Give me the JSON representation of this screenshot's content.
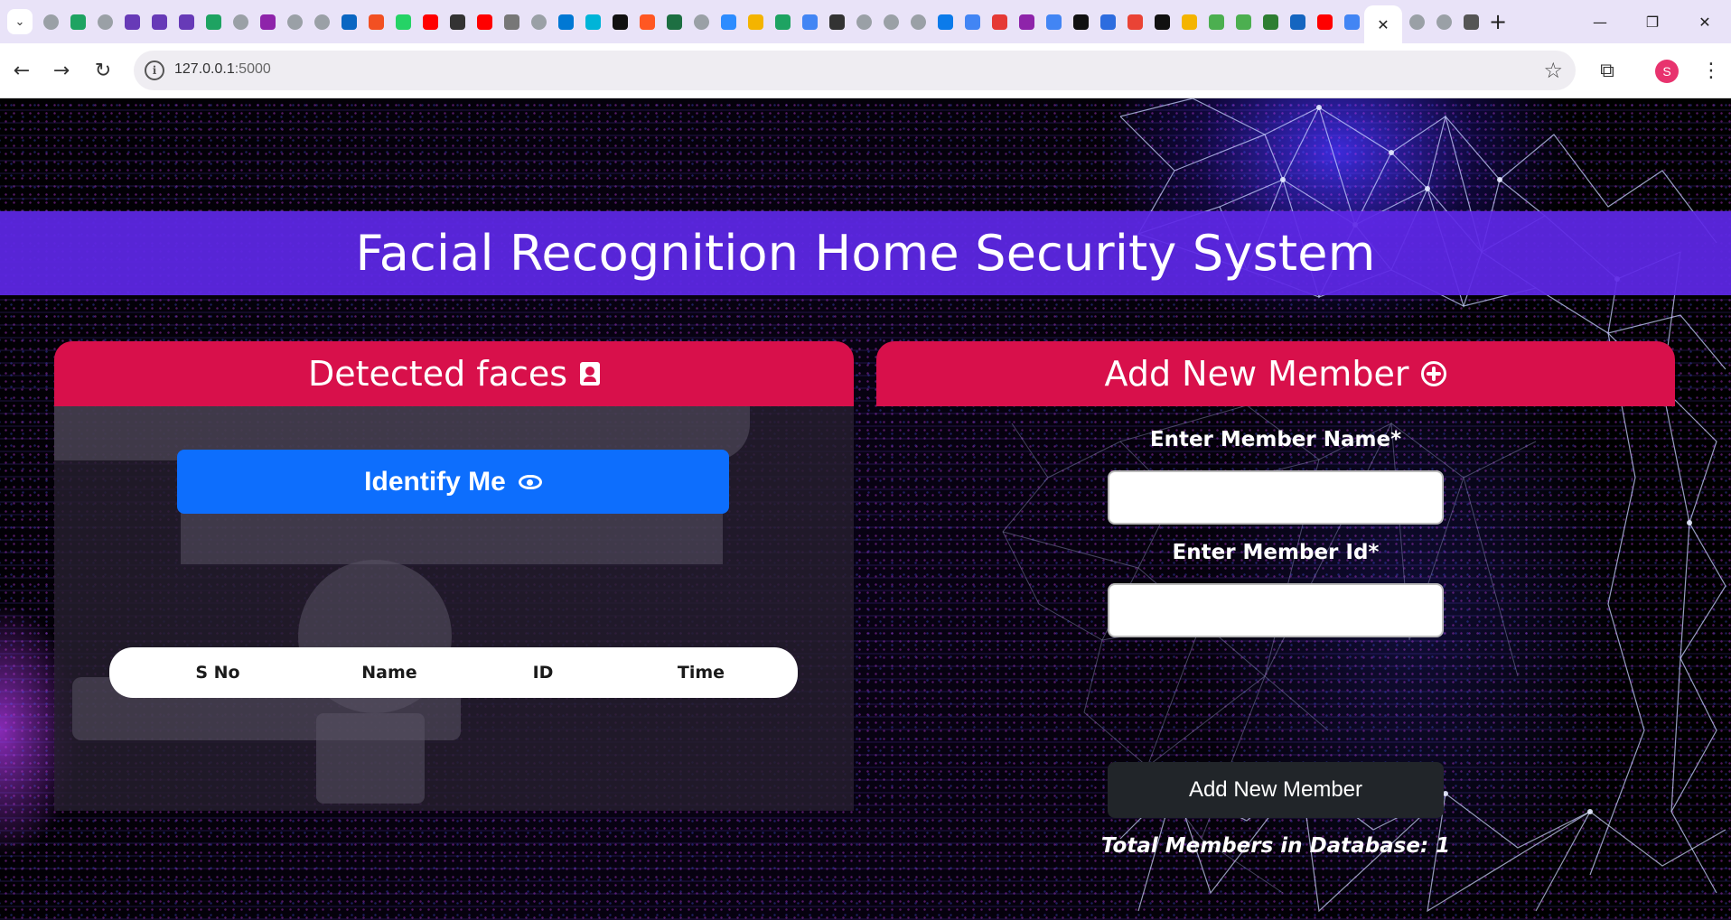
{
  "browser": {
    "url_host": "127.0.0.1",
    "url_port": ":5000",
    "profile_initial": "S",
    "favicons": [
      "#9aa0a6",
      "#1ea362",
      "#9aa0a6",
      "#673ab7",
      "#673ab7",
      "#673ab7",
      "#1ea362",
      "#9aa0a6",
      "#8e24aa",
      "#9aa0a6",
      "#9aa0a6",
      "#0a66c2",
      "#f25022",
      "#25d366",
      "#ff0000",
      "#333333",
      "#ff0000",
      "#777777",
      "#9aa0a6",
      "#0078d4",
      "#00b4d8",
      "#111111",
      "#ff5722",
      "#1d6f42",
      "#9aa0a6",
      "#2d8cff",
      "#f4b400",
      "#1ea362",
      "#4285f4",
      "#333333",
      "#9aa0a6",
      "#9aa0a6",
      "#9aa0a6",
      "#0b7bea",
      "#4285f4",
      "#e53935",
      "#8e24aa",
      "#4285f4",
      "#111111",
      "#2d6cdf",
      "#ea4335",
      "#111111",
      "#f4b400",
      "#4caf50",
      "#4caf50",
      "#2e7d32",
      "#1565c0",
      "#ff0000",
      "#4285f4"
    ],
    "favicons_after": [
      "#9aa0a6",
      "#9aa0a6",
      "#555555"
    ]
  },
  "page": {
    "title": "Facial Recognition Home Security System"
  },
  "detected_faces": {
    "heading": "Detected faces",
    "identify_label": "Identify Me",
    "table_headers": [
      "S No",
      "Name",
      "ID",
      "Time"
    ]
  },
  "add_member": {
    "heading": "Add New Member",
    "name_label": "Enter Member Name*",
    "id_label": "Enter Member Id*",
    "name_value": "",
    "id_value": "",
    "submit_label": "Add New Member",
    "total_text": "Total Members in Database: 1"
  }
}
